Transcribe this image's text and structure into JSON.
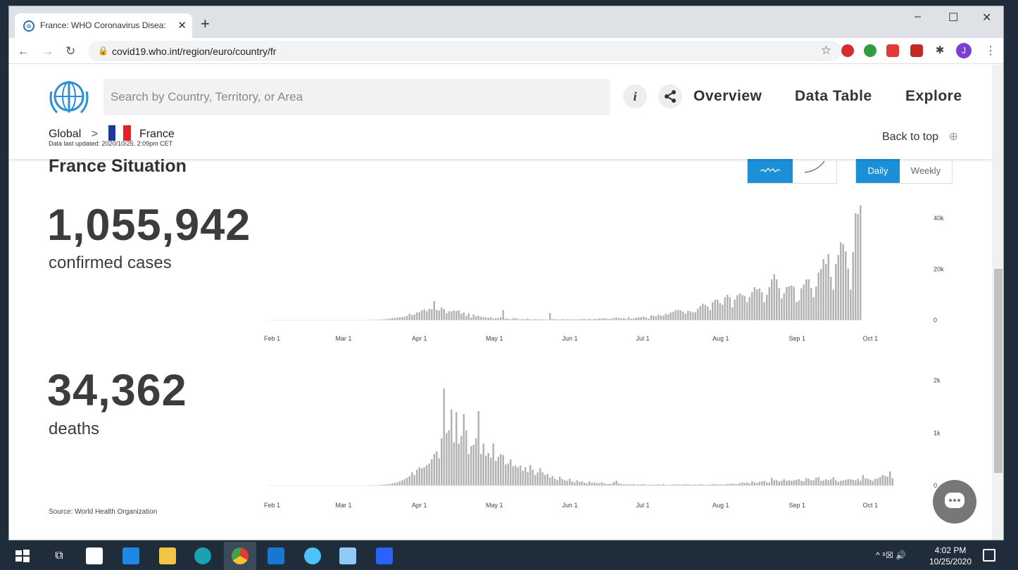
{
  "browser": {
    "tab_title": "France: WHO Coronavirus Disea:",
    "tab_close": "✕",
    "new_tab": "+",
    "url": "covid19.who.int/region/euro/country/fr",
    "window_controls": [
      "–",
      "☐",
      "✕"
    ],
    "profile_initial": "J",
    "extensions": [
      {
        "name": "adblock-icon",
        "color": "#d32f2f"
      },
      {
        "name": "green-ext-icon",
        "color": "#2e9e3e"
      },
      {
        "name": "pocket-icon",
        "color": "#e53935"
      },
      {
        "name": "shield-ext-icon",
        "color": "#c62828"
      },
      {
        "name": "puzzle-icon",
        "color": "#444444"
      }
    ]
  },
  "site": {
    "search_placeholder": "Search by Country, Territory, or Area",
    "info_icon_glyph": "i",
    "nav": {
      "overview": "Overview",
      "data_table": "Data Table",
      "explore": "Explore"
    },
    "breadcrumb": {
      "global": "Global",
      "separator": ">",
      "country": "France"
    },
    "updated": "Data last updated: 2020/10/25, 2:09pm CET",
    "back_to_top": "Back to top",
    "section_title": "France Situation",
    "toggle": {
      "daily": "Daily",
      "weekly": "Weekly"
    },
    "confirmed": {
      "value": "1,055,942",
      "label": "confirmed cases"
    },
    "deaths": {
      "value": "34,362",
      "label": "deaths"
    },
    "source": "Source:  World Health Organization",
    "accent_color": "#1c8fd9"
  },
  "chart_data": [
    {
      "type": "bar",
      "name": "confirmed cases",
      "x_ticks": [
        "Feb 1",
        "Mar 1",
        "Apr 1",
        "May 1",
        "Jun 1",
        "Jul 1",
        "Aug 1",
        "Sep 1",
        "Oct 1"
      ],
      "y_ticks": [
        "40k",
        "20k",
        "0"
      ],
      "ylim": [
        0,
        45000
      ],
      "bar_color": "#b3b3b3",
      "start_date": "2020-02-01",
      "values": [
        0,
        0,
        0,
        0,
        0,
        0,
        0,
        0,
        0,
        0,
        0,
        0,
        0,
        0,
        0,
        0,
        0,
        0,
        0,
        0,
        0,
        0,
        0,
        0,
        0,
        0,
        0,
        0,
        0,
        0,
        0,
        0,
        0,
        0,
        0,
        0,
        0,
        0,
        0,
        0,
        0,
        50,
        100,
        150,
        200,
        250,
        300,
        400,
        500,
        700,
        800,
        900,
        1000,
        1100,
        1200,
        1400,
        1700,
        2500,
        2000,
        2200,
        3000,
        3200,
        3800,
        4200,
        3500,
        4500,
        4300,
        7500,
        4000,
        3800,
        5000,
        4400,
        2700,
        3500,
        3400,
        3800,
        3600,
        3900,
        2500,
        3000,
        1700,
        2700,
        1000,
        2200,
        1500,
        1700,
        1400,
        1200,
        1100,
        900,
        1200,
        600,
        800,
        800,
        1200,
        4000,
        700,
        600,
        400,
        700,
        800,
        500,
        300,
        400,
        400,
        600,
        300,
        300,
        400,
        300,
        350,
        300,
        300,
        200,
        2800,
        500,
        400,
        300,
        300,
        400,
        300,
        400,
        300,
        350,
        300,
        300,
        400,
        500,
        450,
        300,
        600,
        400,
        500,
        500,
        700,
        700,
        800,
        600,
        500,
        700,
        900,
        1000,
        800,
        700,
        800,
        500,
        1200,
        600,
        700,
        1000,
        1100,
        1200,
        1400,
        1000,
        600,
        1900,
        1800,
        1500,
        2200,
        1700,
        1800,
        2500,
        2200,
        3000,
        3300,
        4000,
        4000,
        3800,
        3400,
        2500,
        3700,
        3500,
        3100,
        3200,
        4500,
        5500,
        6500,
        6000,
        5400,
        4000,
        7000,
        8000,
        8000,
        6800,
        6100,
        9000,
        10000,
        9000,
        5100,
        8100,
        9800,
        10500,
        9900,
        9500,
        7100,
        9100,
        11000,
        13000,
        12000,
        12400,
        11000,
        7000,
        10000,
        13000,
        16000,
        18000,
        16000,
        12600,
        8500,
        10500,
        13000,
        13300,
        13600,
        13100,
        7100,
        7700,
        12500,
        14000,
        16000,
        16000,
        12600,
        9000,
        13300,
        18700,
        20100,
        24000,
        22000,
        26000,
        17000,
        12000,
        22000,
        25600,
        30600,
        29800,
        27000,
        20200,
        12000,
        26700,
        42000,
        41600,
        45000
      ]
    },
    {
      "type": "bar",
      "name": "deaths",
      "x_ticks": [
        "Feb 1",
        "Mar 1",
        "Apr 1",
        "May 1",
        "Jun 1",
        "Jul 1",
        "Aug 1",
        "Sep 1",
        "Oct 1"
      ],
      "y_ticks": [
        "2k",
        "1k",
        "0"
      ],
      "ylim": [
        0,
        2050
      ],
      "bar_color": "#b3b3b3",
      "start_date": "2020-02-01",
      "values": [
        0,
        0,
        0,
        0,
        0,
        0,
        0,
        0,
        0,
        0,
        0,
        0,
        0,
        0,
        0,
        0,
        0,
        0,
        0,
        0,
        0,
        0,
        0,
        0,
        0,
        0,
        0,
        0,
        0,
        0,
        0,
        0,
        0,
        0,
        0,
        0,
        0,
        0,
        0,
        0,
        0,
        2,
        3,
        5,
        8,
        10,
        15,
        20,
        25,
        30,
        40,
        50,
        60,
        80,
        100,
        120,
        150,
        180,
        250,
        200,
        300,
        350,
        330,
        350,
        390,
        420,
        500,
        600,
        650,
        520,
        900,
        1850,
        1000,
        1050,
        1450,
        820,
        1400,
        800,
        950,
        1360,
        1050,
        600,
        750,
        780,
        900,
        1420,
        600,
        800,
        570,
        620,
        530,
        800,
        470,
        550,
        600,
        580,
        400,
        420,
        500,
        370,
        380,
        350,
        380,
        280,
        350,
        260,
        390,
        300,
        200,
        250,
        330,
        250,
        200,
        220,
        150,
        180,
        130,
        100,
        170,
        120,
        100,
        90,
        130,
        80,
        60,
        100,
        70,
        80,
        55,
        40,
        80,
        50,
        60,
        50,
        45,
        60,
        40,
        30,
        30,
        35,
        70,
        90,
        40,
        30,
        30,
        20,
        25,
        20,
        30,
        15,
        20,
        20,
        30,
        15,
        15,
        20,
        15,
        20,
        20,
        15,
        25,
        15,
        10,
        15,
        20,
        20,
        25,
        15,
        20,
        25,
        20,
        20,
        15,
        20,
        15,
        25,
        20,
        15,
        15,
        20,
        25,
        30,
        20,
        25,
        20,
        20,
        30,
        35,
        40,
        30,
        30,
        45,
        60,
        50,
        60,
        40,
        80,
        60,
        50,
        70,
        80,
        90,
        60,
        60,
        150,
        100,
        100,
        80,
        90,
        120,
        90,
        100,
        90,
        100,
        110,
        120,
        90,
        80,
        140,
        130,
        100,
        100,
        150,
        160,
        90,
        100,
        120,
        100,
        120,
        160,
        100,
        70,
        90,
        100,
        110,
        120,
        120,
        110,
        100,
        130,
        90,
        200,
        140,
        130,
        110,
        90,
        130,
        140,
        160,
        200,
        180,
        170,
        270,
        140
      ]
    }
  ],
  "taskbar": {
    "clock_time": "4:02 PM",
    "clock_date": "10/25/2020",
    "tray_text": "^  ⁹☒  🔊"
  }
}
